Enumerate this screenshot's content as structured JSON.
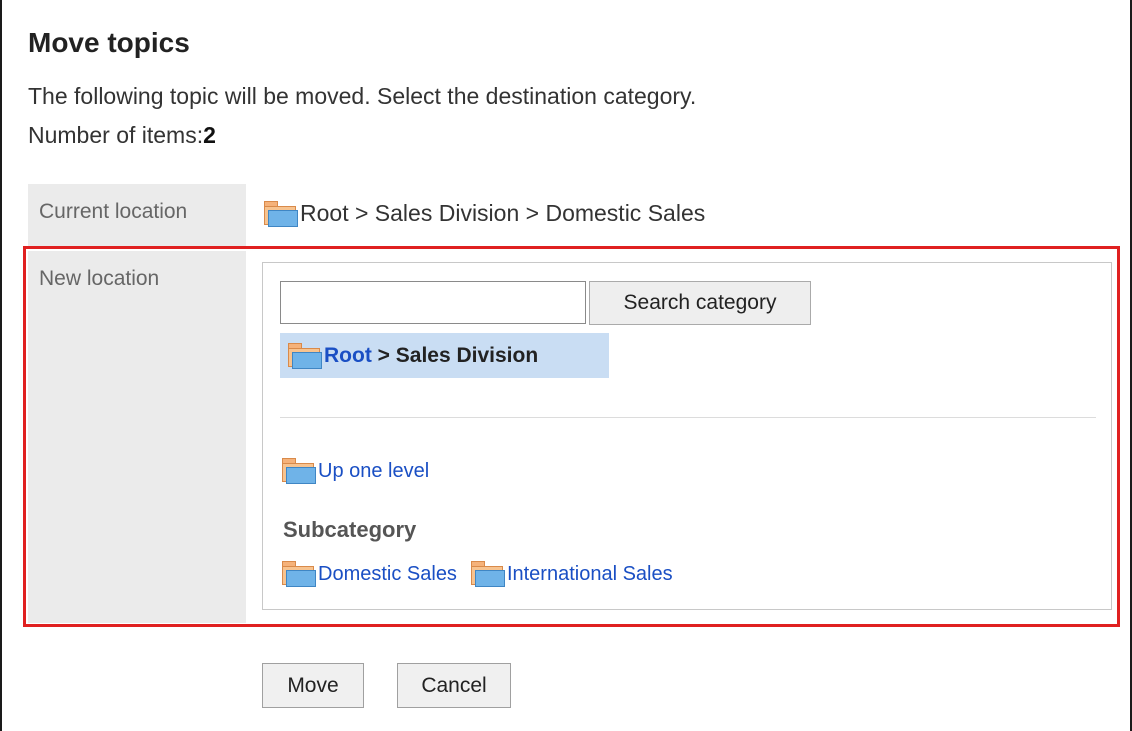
{
  "page": {
    "title": "Move topics",
    "description": "The following topic will be moved. Select the destination category.",
    "count_label": "Number of items:",
    "count_value": "2"
  },
  "current_location": {
    "label": "Current location",
    "path": "Root > Sales Division > Domestic Sales",
    "icon": "folder-icon"
  },
  "new_location": {
    "label": "New location",
    "search": {
      "value": "",
      "placeholder": "",
      "button_label": "Search category"
    },
    "selected": {
      "root_label": "Root",
      "rest_label": " > Sales Division"
    },
    "up_level_label": "Up one level",
    "subcategory_title": "Subcategory",
    "subcategories": [
      {
        "label": "Domestic Sales"
      },
      {
        "label": "International Sales"
      }
    ]
  },
  "actions": {
    "move_label": "Move",
    "cancel_label": "Cancel"
  },
  "colors": {
    "highlight_border": "#e02020",
    "link": "#1a4fc4",
    "selected_bg": "#c9ddf3",
    "label_cell_bg": "#ebebeb"
  }
}
